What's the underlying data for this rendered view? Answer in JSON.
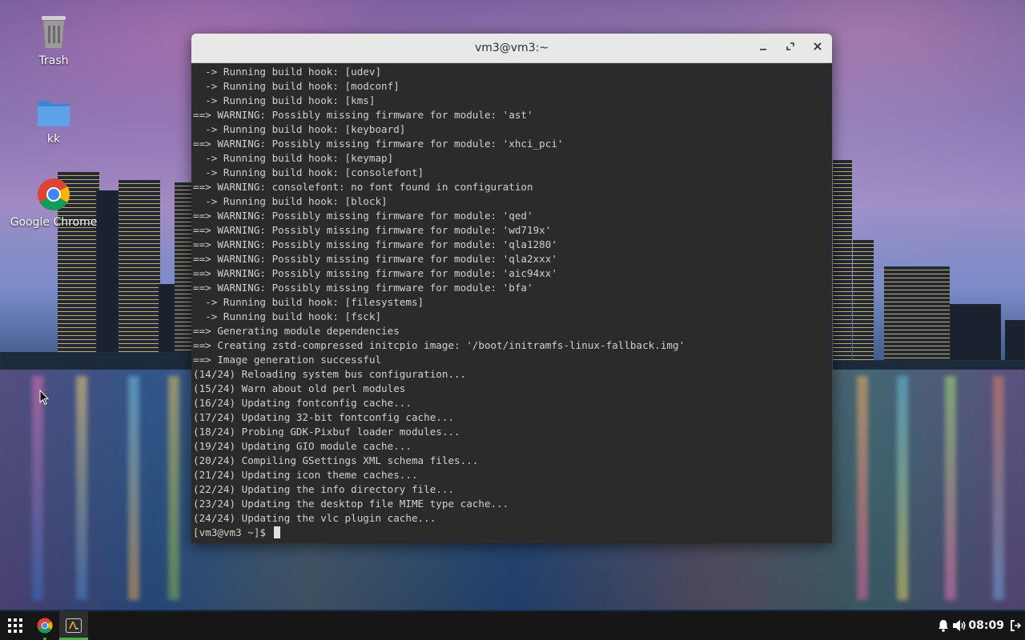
{
  "desktop": {
    "icons": [
      {
        "label": "Trash",
        "icon": "trash-icon"
      },
      {
        "label": "kk",
        "icon": "folder-icon"
      },
      {
        "label": "Google Chrome",
        "icon": "chrome-icon"
      }
    ]
  },
  "terminal": {
    "title": "vm3@vm3:~",
    "lines": [
      "  -> Running build hook: [udev]",
      "  -> Running build hook: [modconf]",
      "  -> Running build hook: [kms]",
      "==> WARNING: Possibly missing firmware for module: 'ast'",
      "  -> Running build hook: [keyboard]",
      "==> WARNING: Possibly missing firmware for module: 'xhci_pci'",
      "  -> Running build hook: [keymap]",
      "  -> Running build hook: [consolefont]",
      "==> WARNING: consolefont: no font found in configuration",
      "  -> Running build hook: [block]",
      "==> WARNING: Possibly missing firmware for module: 'qed'",
      "==> WARNING: Possibly missing firmware for module: 'wd719x'",
      "==> WARNING: Possibly missing firmware for module: 'qla1280'",
      "==> WARNING: Possibly missing firmware for module: 'qla2xxx'",
      "==> WARNING: Possibly missing firmware for module: 'aic94xx'",
      "==> WARNING: Possibly missing firmware for module: 'bfa'",
      "  -> Running build hook: [filesystems]",
      "  -> Running build hook: [fsck]",
      "==> Generating module dependencies",
      "==> Creating zstd-compressed initcpio image: '/boot/initramfs-linux-fallback.img'",
      "==> Image generation successful",
      "(14/24) Reloading system bus configuration...",
      "(15/24) Warn about old perl modules",
      "(16/24) Updating fontconfig cache...",
      "(17/24) Updating 32-bit fontconfig cache...",
      "(18/24) Probing GDK-Pixbuf loader modules...",
      "(19/24) Updating GIO module cache...",
      "(20/24) Compiling GSettings XML schema files...",
      "(21/24) Updating icon theme caches...",
      "(22/24) Updating the info directory file...",
      "(23/24) Updating the desktop file MIME type cache...",
      "(24/24) Updating the vlc plugin cache..."
    ],
    "prompt": "[vm3@vm3 ~]$ ",
    "buttons": {
      "minimize": "minimize-icon",
      "maximize": "maximize-icon",
      "close": "close-icon"
    }
  },
  "taskbar": {
    "apps": [
      "app-grid-icon",
      "chrome-icon",
      "terminal-icon"
    ],
    "tray": [
      "bell-icon",
      "volume-icon",
      "logout-icon"
    ],
    "clock": "08:09"
  },
  "colors": {
    "terminal_bg": "#2b2b2b",
    "titlebar_bg": "#e8e8e7",
    "taskbar_bg": "#161616",
    "active_indicator": "#4caf50"
  }
}
